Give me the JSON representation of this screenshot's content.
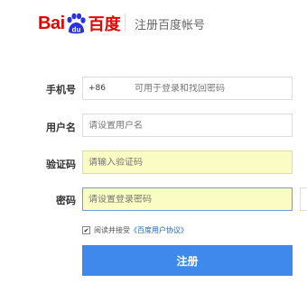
{
  "header": {
    "logo_bai": "Bai",
    "logo_du": "du",
    "logo_cn": "百度",
    "title": "注册百度帐号"
  },
  "form": {
    "phone": {
      "label": "手机号",
      "prefix": "+86",
      "placeholder": "可用于登录和找回密码"
    },
    "username": {
      "label": "用户名",
      "placeholder": "请设置用户名"
    },
    "captcha": {
      "label": "验证码",
      "placeholder": "请输入验证码"
    },
    "password": {
      "label": "密码",
      "placeholder": "请设置登录密码"
    },
    "agree": {
      "text": "阅读并接受",
      "link": "《百度用户协议》",
      "checked": true
    },
    "submit_label": "注册"
  },
  "colors": {
    "brand_red": "#e10601",
    "button_blue": "#3f89ec",
    "autofill_yellow": "#fafcc4"
  }
}
